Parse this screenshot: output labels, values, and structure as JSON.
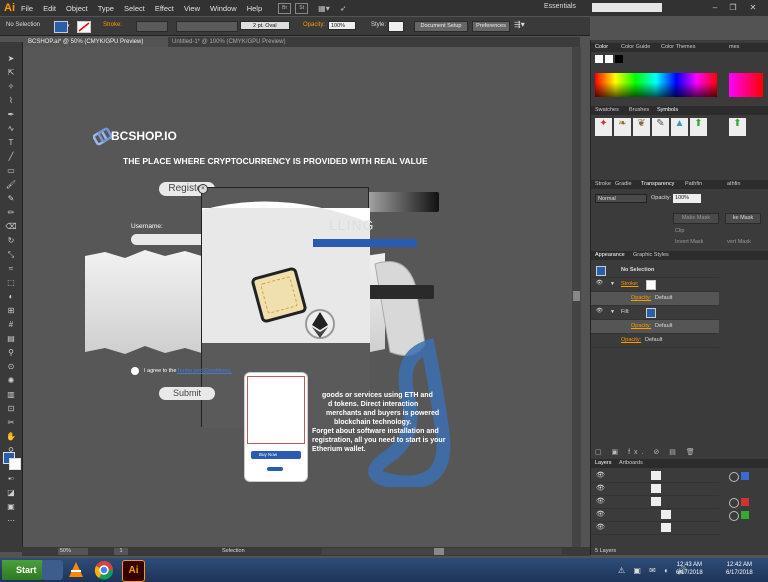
{
  "menubar": {
    "app_logo": "Ai",
    "items": [
      "File",
      "Edit",
      "Object",
      "Type",
      "Select",
      "Effect",
      "View",
      "Window",
      "Help"
    ],
    "bridge_btn": "Br",
    "stock_btn": "St",
    "workspace": "Essentials"
  },
  "controlbar": {
    "selection_label": "No Selection",
    "stroke_label": "Stroke:",
    "brush_label": "2 pt. Oval",
    "opacity_label": "Opacity:",
    "opacity_value": "100%",
    "style_label": "Style:",
    "document_setup": "Document Setup",
    "preferences": "Preferences"
  },
  "tabs": [
    {
      "label": "BCSHOP.ai* @ 50% (CMYK/GPU Preview)"
    },
    {
      "label": "Untitled-1* @ 100% (CMYK/GPU Preview)"
    }
  ],
  "artwork": {
    "brand": "BCSHOP.IO",
    "headline": "THE PLACE WHERE CRYPTOCURRENCY IS PROVIDED WITH REAL VALUE",
    "register_btn": "Register",
    "username_label": "Username:",
    "selling_text": "LLING",
    "agree_text": "I agree to the",
    "terms_link": "Terms and Conditions.",
    "submit_btn": "Submit",
    "body_text": [
      "goods or services using ETH and",
      "d tokens. Direct interaction",
      "merchants and buyers is powered",
      "blockchain technology.",
      "Forget about software installation and",
      "registration, all you need to start is your",
      "Etherium wallet."
    ],
    "buy_now": "Buy Now"
  },
  "panels": {
    "color_tabs": [
      "Color",
      "Color Guide",
      "Color Themes"
    ],
    "color_tab_right": "mes",
    "swatch_tabs": [
      "Swatches",
      "Brushes",
      "Symbols"
    ],
    "stroke_tabs": [
      "Stroke",
      "Gradie",
      "Transparency",
      "Pathfin"
    ],
    "stroke_tab_right": "athfin",
    "blend_mode": "Normal",
    "opacity_label": "Opacity:",
    "opacity_value": "100%",
    "make_mask": "Make Mask",
    "make_mask_right": "ke Mask",
    "clip": "Clip",
    "invert_mask": "Invert Mask",
    "invert_mask_right": "vert Mask",
    "appearance_tabs": [
      "Appearance",
      "Graphic Styles"
    ],
    "appearance_rows": [
      {
        "label": "No Selection"
      },
      {
        "label": "Stroke:"
      },
      {
        "label": "Opacity:",
        "value": "Default"
      },
      {
        "label": "Fill:"
      },
      {
        "label": "Opacity:",
        "value": "Default"
      },
      {
        "label": "Opacity:",
        "value": "Default"
      }
    ],
    "layers_tabs": [
      "Layers",
      "Artboards"
    ],
    "layers_footer": "5 Layers"
  },
  "statusbar": {
    "zoom": "50%",
    "page": "1",
    "tool": "Selection"
  },
  "taskbar": {
    "start": "Start",
    "time_left": "12:43 AM",
    "date_left": "6/17/2018",
    "time_right": "12:42 AM",
    "date_right": "6/17/2018"
  },
  "colors": {
    "accent_orange": "#ff9a00",
    "swatch_blue": "#2b5eaa",
    "button_blue": "#2a5bb0"
  }
}
